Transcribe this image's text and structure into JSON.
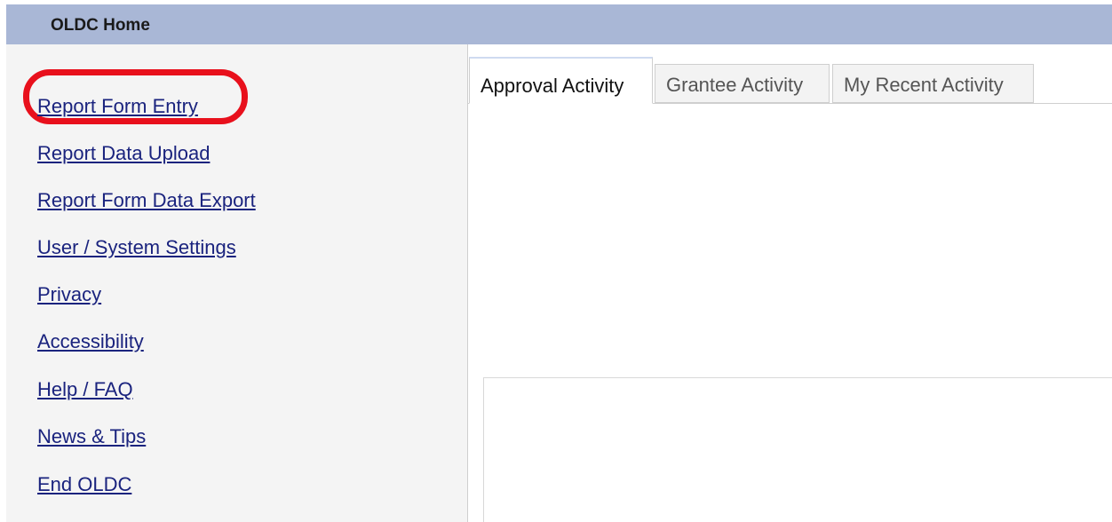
{
  "header": {
    "title": "OLDC Home"
  },
  "sidebar": {
    "items": [
      {
        "label": "Report Form Entry",
        "highlighted": true
      },
      {
        "label": "Report Data Upload"
      },
      {
        "label": "Report Form Data Export"
      },
      {
        "label": "User / System Settings"
      },
      {
        "label": "Privacy"
      },
      {
        "label": "Accessibility"
      },
      {
        "label": "Help / FAQ"
      },
      {
        "label": "News & Tips"
      },
      {
        "label": "End OLDC"
      }
    ]
  },
  "main": {
    "tabs": [
      {
        "label": "Approval Activity",
        "active": true
      },
      {
        "label": "Grantee Activity",
        "active": false
      },
      {
        "label": "My Recent Activity",
        "active": false
      }
    ]
  },
  "colors": {
    "title_bar": "#a9b7d6",
    "link": "#1a237e",
    "highlight_ring": "#e8101c",
    "sidebar_bg": "#f4f4f4"
  }
}
